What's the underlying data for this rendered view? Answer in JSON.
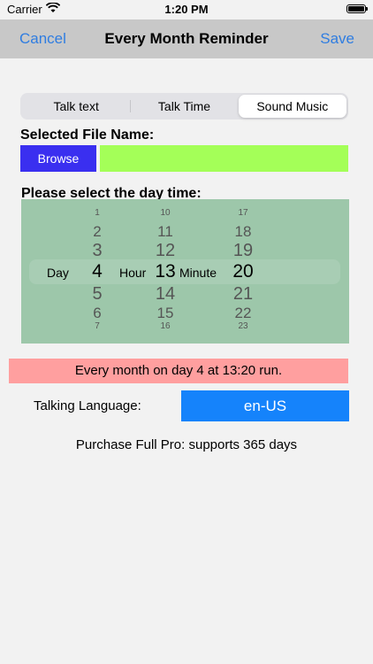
{
  "status": {
    "carrier": "Carrier",
    "time": "1:20 PM"
  },
  "nav": {
    "cancel": "Cancel",
    "title": "Every Month Reminder",
    "save": "Save"
  },
  "tabs": [
    {
      "label": "Talk text"
    },
    {
      "label": "Talk Time"
    },
    {
      "label": "Sound Music"
    }
  ],
  "selected_tab": "Sound Music",
  "file": {
    "label": "Selected File Name:",
    "browse": "Browse",
    "value": ""
  },
  "picker": {
    "title": "Please select the day time:",
    "day_label": "Day",
    "hour_label": "Hour",
    "minute_label": "Minute",
    "day": [
      "1",
      "2",
      "3",
      "4",
      "5",
      "6",
      "7"
    ],
    "hour": [
      "10",
      "11",
      "12",
      "13",
      "14",
      "15",
      "16"
    ],
    "minute": [
      "17",
      "18",
      "19",
      "20",
      "21",
      "22",
      "23"
    ],
    "selected": {
      "day": "4",
      "hour": "13",
      "minute": "20"
    }
  },
  "banner": "Every month on day 4 at 13:20 run.",
  "language": {
    "label": "Talking Language:",
    "value": "en-US"
  },
  "promo": "Purchase Full Pro: supports 365 days",
  "colors": {
    "nav_bg": "#c8c8c8",
    "accent": "#2f7de1",
    "browse_bg": "#3a2ff0",
    "file_field_bg": "#a4ff58",
    "picker_bg": "#9dc7aa",
    "banner_bg": "#ff9f9f",
    "language_bg": "#1583fb"
  }
}
